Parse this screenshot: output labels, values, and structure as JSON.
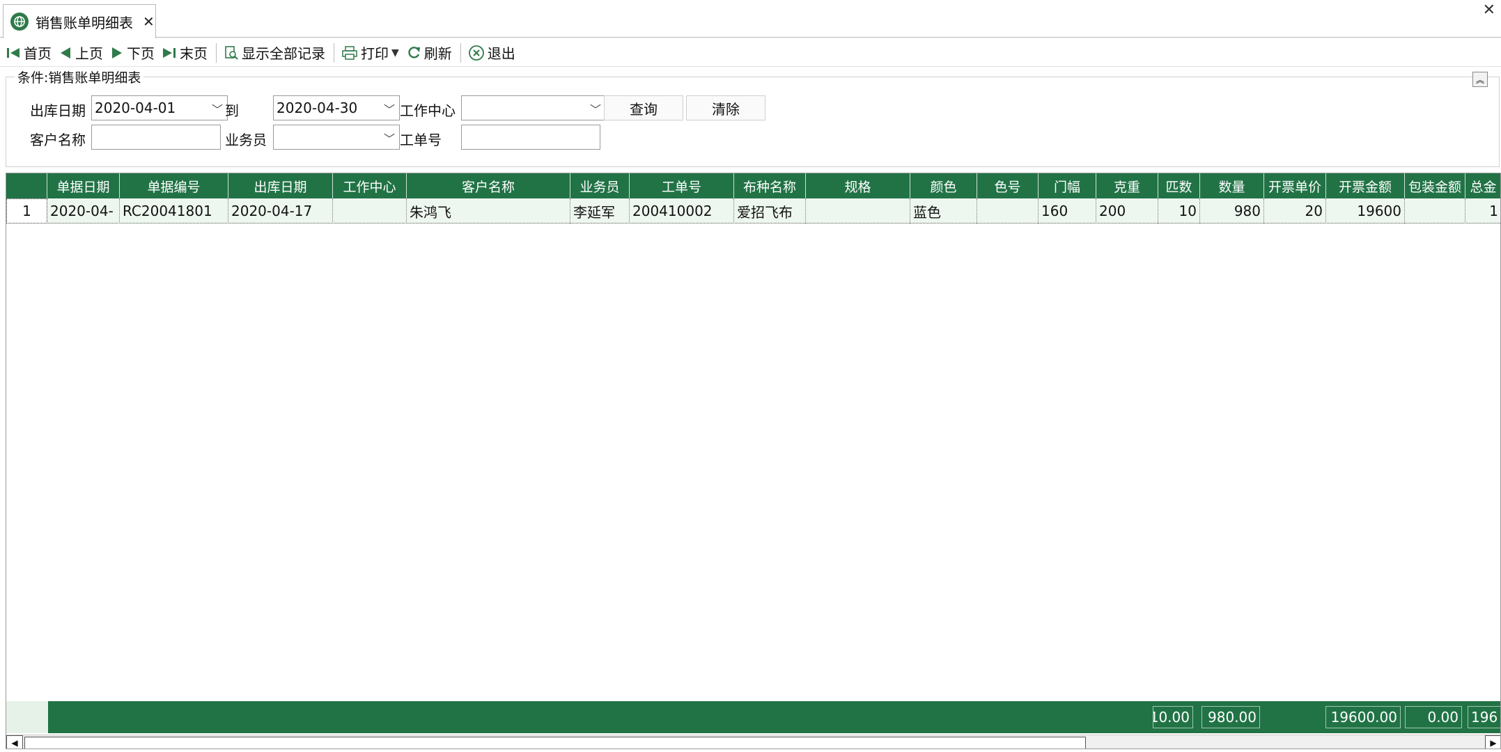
{
  "tab": {
    "title": "销售账单明细表",
    "close": "✕"
  },
  "window": {
    "close": "✕"
  },
  "toolbar": {
    "first": "首页",
    "prev": "上页",
    "next": "下页",
    "last": "末页",
    "show_all": "显示全部记录",
    "print": "打印",
    "refresh": "刷新",
    "exit": "退出"
  },
  "conditions": {
    "legend": "条件:销售账单明细表",
    "date_label": "出库日期",
    "date_from": "2020-04-01",
    "to_label": "到",
    "date_to": "2020-04-30",
    "workcenter_label": "工作中心",
    "workcenter_value": "",
    "query_button": "查询",
    "clear_button": "清除",
    "customer_label": "客户名称",
    "customer_value": "",
    "salesman_label": "业务员",
    "salesman_value": "",
    "workorder_label": "工单号",
    "workorder_value": ""
  },
  "grid": {
    "columns": [
      "单据日期",
      "单据编号",
      "出库日期",
      "工作中心",
      "客户名称",
      "业务员",
      "工单号",
      "布种名称",
      "规格",
      "颜色",
      "色号",
      "门幅",
      "克重",
      "匹数",
      "数量",
      "开票单价",
      "开票金额",
      "包装金额",
      "总金"
    ],
    "rows": [
      {
        "row_no": "1",
        "cells": [
          "2020-04-",
          "RC20041801",
          "2020-04-17",
          "",
          "朱鸿飞",
          "李延军",
          "200410002",
          "爱招飞布",
          "",
          "蓝色",
          "",
          "160",
          "200",
          "10",
          "980",
          "20",
          "19600",
          "",
          "1"
        ]
      }
    ],
    "totals": {
      "pieces": "10.00",
      "quantity": "980.00",
      "invoice_amount": "19600.00",
      "packing_amount": "0.00",
      "total_amount": "196"
    }
  }
}
